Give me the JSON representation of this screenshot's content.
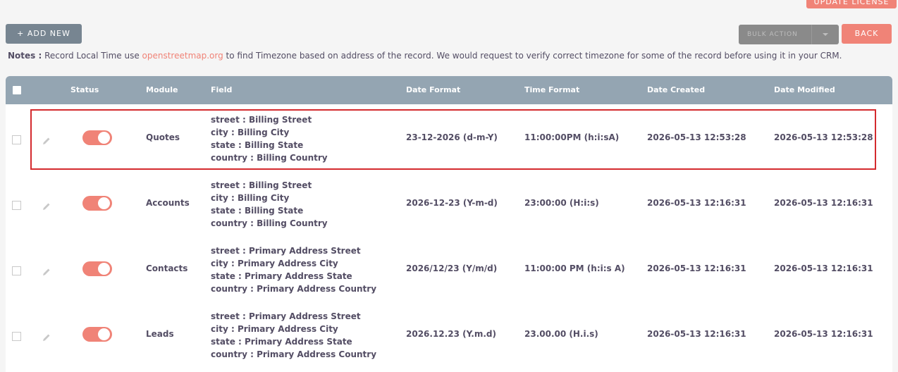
{
  "toolbar": {
    "update_license_label": "UPDATE LICENSE",
    "add_new_label": "+ ADD NEW",
    "bulk_action_label": "BULK ACTION",
    "back_label": "BACK"
  },
  "notes": {
    "prefix": "Notes :",
    "text_before_link": " Record Local Time use ",
    "link_text": "openstreetmap.org",
    "text_after_link": " to find Timezone based on address of the record. We would request to verify correct timezone for some of the record before using it in your CRM."
  },
  "table": {
    "columns": {
      "status": "Status",
      "module": "Module",
      "field": "Field",
      "date_format": "Date Format",
      "time_format": "Time Format",
      "date_created": "Date Created",
      "date_modified": "Date Modified"
    },
    "rows": [
      {
        "module": "Quotes",
        "fields": [
          "street : Billing Street",
          "city : Billing City",
          "state : Billing State",
          "country : Billing Country"
        ],
        "date_format": "23-12-2026 (d-m-Y)",
        "time_format": "11:00:00PM (h:i:sA)",
        "date_created": "2026-05-13 12:53:28",
        "date_modified": "2026-05-13 12:53:28"
      },
      {
        "module": "Accounts",
        "fields": [
          "street : Billing Street",
          "city : Billing City",
          "state : Billing State",
          "country : Billing Country"
        ],
        "date_format": "2026-12-23 (Y-m-d)",
        "time_format": "23:00:00 (H:i:s)",
        "date_created": "2026-05-13 12:16:31",
        "date_modified": "2026-05-13 12:16:31"
      },
      {
        "module": "Contacts",
        "fields": [
          "street : Primary Address Street",
          "city : Primary Address City",
          "state : Primary Address State",
          "country : Primary Address Country"
        ],
        "date_format": "2026/12/23 (Y/m/d)",
        "time_format": "11:00:00 PM (h:i:s A)",
        "date_created": "2026-05-13 12:16:31",
        "date_modified": "2026-05-13 12:16:31"
      },
      {
        "module": "Leads",
        "fields": [
          "street : Primary Address Street",
          "city : Primary Address City",
          "state : Primary Address State",
          "country : Primary Address Country"
        ],
        "date_format": "2026.12.23 (Y.m.d)",
        "time_format": "23.00.00 (H.i.s)",
        "date_created": "2026-05-13 12:16:31",
        "date_modified": "2026-05-13 12:16:31"
      }
    ]
  },
  "colors": {
    "accent": "#f08377",
    "header_bg": "#94a5b2",
    "add_button_bg": "#778591",
    "highlight_border": "#d42a2e"
  },
  "icons": {
    "row_edit": "pencil-icon",
    "bulk_caret": "chevron-down-icon"
  }
}
